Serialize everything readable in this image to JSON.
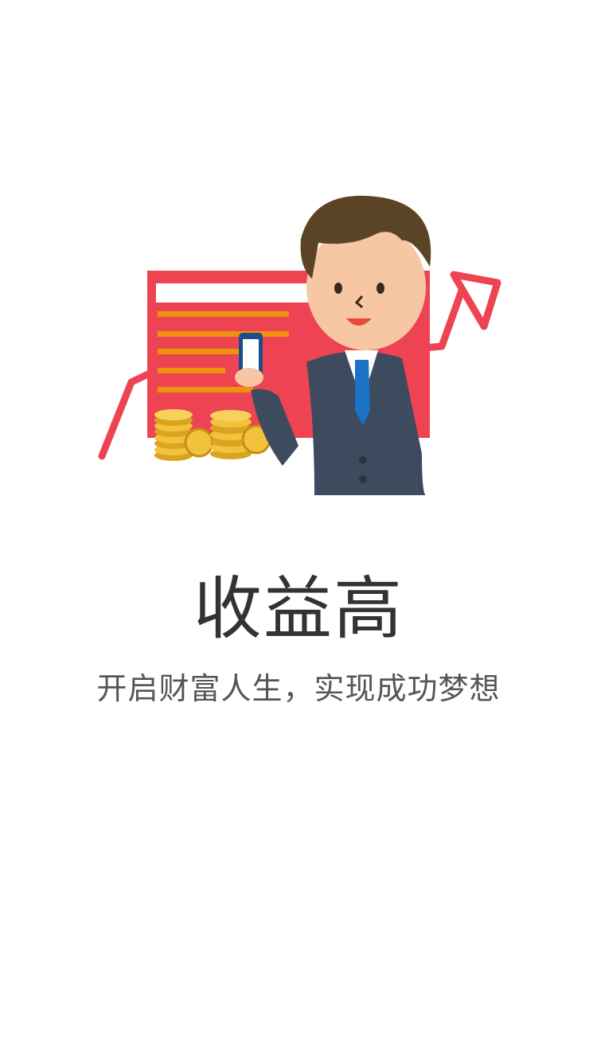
{
  "splash": {
    "title": "收益高",
    "subtitle": "开启财富人生，实现成功梦想"
  },
  "illustration": {
    "icon": "businessman-with-phone-and-coins-icon",
    "colors": {
      "board": "#EE4352",
      "board_lines": "#F0930C",
      "arrow": "#EE4352",
      "coin": "#F2C23D",
      "suit": "#3E4A5E",
      "hair": "#5B4425",
      "skin": "#F7C7A3",
      "tie": "#1B73C5"
    }
  },
  "theme": {
    "background": "#FFFFFF",
    "title_color": "#333333",
    "subtitle_color": "#555555"
  }
}
